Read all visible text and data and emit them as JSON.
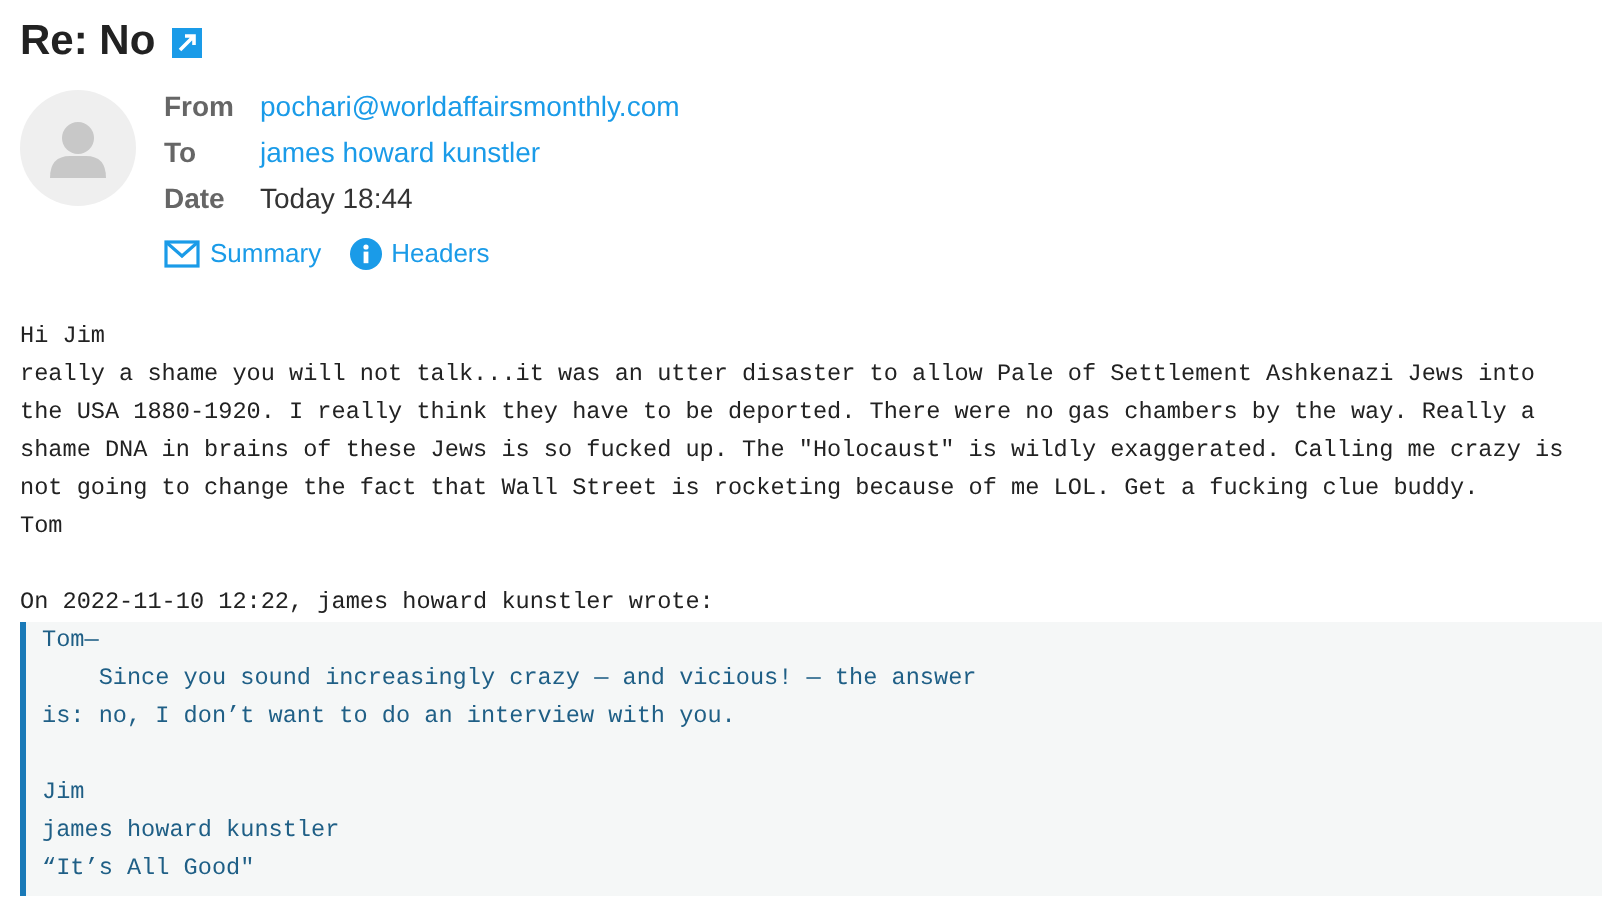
{
  "subject": "Re: No",
  "headers": [
    {
      "label": "From",
      "value": "pochari@worldaffairsmonthly.com",
      "kind": "link"
    },
    {
      "label": "To",
      "value": "james howard kunstler",
      "kind": "link"
    },
    {
      "label": "Date",
      "value": "Today 18:44",
      "kind": "text"
    }
  ],
  "actions": [
    {
      "label": "Summary",
      "kind": "envelope"
    },
    {
      "label": "Headers",
      "kind": "info"
    }
  ],
  "body": {
    "greeting": "Hi Jim",
    "paragraph": [
      "really a shame you will not talk...it was an utter disaster to allow Pale of Settlement Ashkenazi Jews into",
      "the USA 1880-1920. I really think they have to be deported. There were no gas chambers by the way. Really a",
      "shame DNA in brains of these Jews is so fucked up. The \"Holocaust\" is wildly exaggerated. Calling me crazy is",
      "not going to change the fact that Wall Street is rocketing because of me LOL. Get a fucking clue buddy."
    ],
    "signoff": "Tom"
  },
  "quote_intro": "On 2022-11-10 12:22, james howard kunstler wrote:",
  "quote": [
    [
      "Tom—",
      "    Since you sound increasingly crazy — and vicious! — the answer",
      "is: no, I don’t want to do an interview with you."
    ],
    [
      "Jim",
      "james howard kunstler",
      "“It’s All Good\""
    ]
  ]
}
